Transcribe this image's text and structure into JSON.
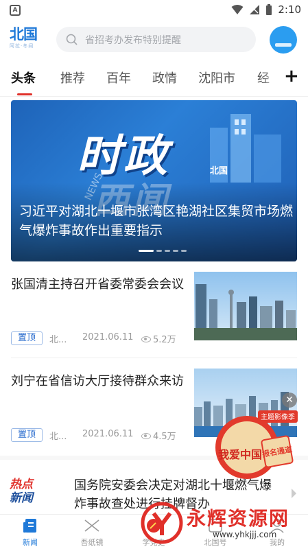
{
  "status_bar": {
    "time": "2:10",
    "left_icon": "A"
  },
  "header": {
    "logo_main": "北国",
    "logo_sub": "阿拉·冬闻",
    "search_placeholder": "省招考办发布特别提醒"
  },
  "tabs": [
    "头条",
    "推荐",
    "百年",
    "政情",
    "沈阳市",
    "经"
  ],
  "banner": {
    "big_text": "时政",
    "big_text_2": "西闻",
    "brand": "北国",
    "watermark": "NEWS",
    "title": "习近平对湖北十堰市张湾区艳湖社区集贸市场燃气爆炸事故作出重要指示"
  },
  "articles": [
    {
      "title": "张国清主持召开省委常委会会议",
      "pin": "置顶",
      "source": "北...",
      "date": "2021.06.11",
      "views": "5.2万"
    },
    {
      "title": "刘宁在省信访大厅接待群众来访",
      "pin": "置顶",
      "source": "北...",
      "date": "2021.06.11",
      "views": "4.5万"
    }
  ],
  "hot": {
    "label_1": "热点",
    "label_2": "新闻",
    "text": "国务院安委会决定对湖北十堰燃气爆炸事故查处进行挂牌督办"
  },
  "float_ad": {
    "badge": "主题影像季",
    "line": "我爱中国",
    "stamp": "报名通道"
  },
  "bottom_nav": [
    {
      "label": "新闻",
      "icon": "news-icon"
    },
    {
      "label": "吾纸镜",
      "icon": "paper-mirror-icon"
    },
    {
      "label": "学党史",
      "icon": "party-history-icon"
    },
    {
      "label": "北国号",
      "icon": "account-icon"
    },
    {
      "label": "我的",
      "icon": "profile-icon"
    }
  ],
  "watermark": {
    "text": "永辉资源网",
    "url": "www.yhkjjj.com"
  },
  "colors": {
    "accent": "#1f79d8",
    "red": "#e0302a"
  }
}
